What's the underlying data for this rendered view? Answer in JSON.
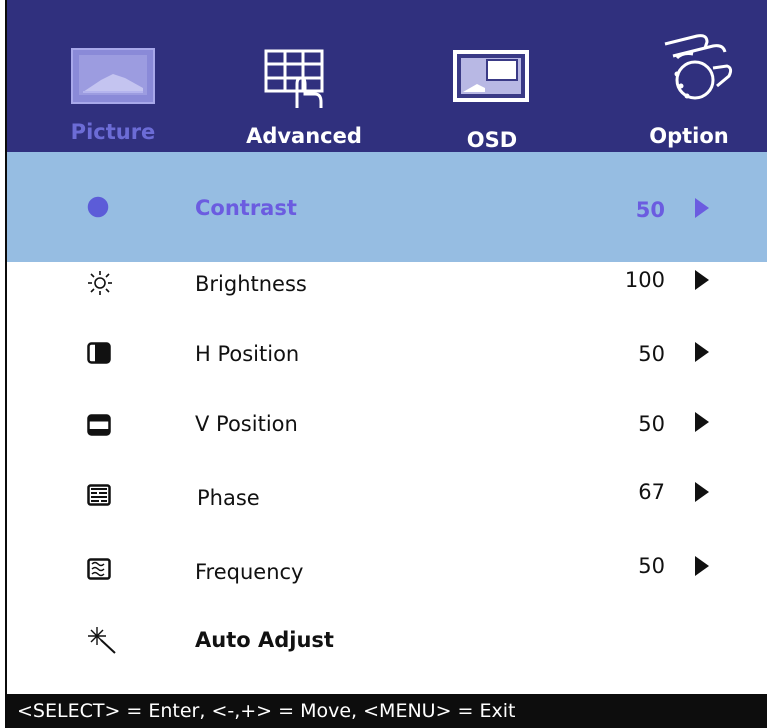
{
  "tabs": [
    {
      "label": "Picture",
      "icon": "picture-icon",
      "active": true
    },
    {
      "label": "Advanced",
      "icon": "grid-touch-icon",
      "active": false
    },
    {
      "label": "OSD",
      "icon": "osd-screen-icon",
      "active": false
    },
    {
      "label": "Option",
      "icon": "hand-dial-icon",
      "active": false
    }
  ],
  "menu": [
    {
      "label": "Contrast",
      "value": "50",
      "icon": "contrast-icon",
      "selected": true
    },
    {
      "label": "Brightness",
      "value": "100",
      "icon": "brightness-icon"
    },
    {
      "label": "H Position",
      "value": "50",
      "icon": "h-position-icon"
    },
    {
      "label": "V Position",
      "value": "50",
      "icon": "v-position-icon"
    },
    {
      "label": "Phase",
      "value": "67",
      "icon": "phase-icon"
    },
    {
      "label": "Frequency",
      "value": "50",
      "icon": "frequency-icon"
    },
    {
      "label": "Auto Adjust",
      "value": "",
      "icon": "magic-wand-icon"
    }
  ],
  "footer": {
    "hint": "<SELECT> = Enter, <-,+> = Move, <MENU> = Exit"
  },
  "colors": {
    "tabbar_bg": "#30307e",
    "active_tab": "#6c6cd6",
    "selected_row_bg": "#96bde2",
    "selected_text": "#6b5ce0",
    "footer_bg": "#0d0d0d"
  }
}
